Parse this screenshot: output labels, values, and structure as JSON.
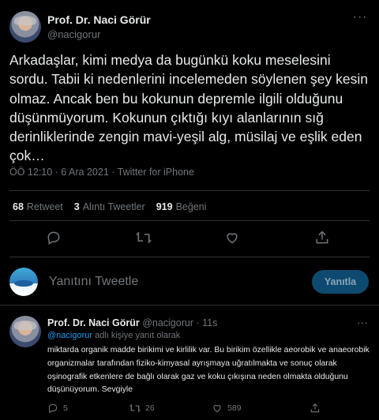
{
  "main_tweet": {
    "author_name": "Prof. Dr. Naci Görür",
    "author_handle": "@nacigorur",
    "text": "Arkadaşlar, kimi medya da bugünkü koku meselesini sordu. Tabii ki nedenlerini incelemeden söylenen şey kesin olmaz. Ancak ben bu kokunun depremle ilgili olduğunu düşünmüyorum. Kokunun çıktığı kıyı alanlarının sığ derinliklerinde zengin mavi-yeşil alg, müsilaj ve eşlik eden çok…",
    "meta": "ÖÖ 12:10 · 6 Ara 2021 · Twitter for iPhone",
    "stats": {
      "retweets_count": "68",
      "retweets_label": "Retweet",
      "quotes_count": "3",
      "quotes_label": "Alıntı Tweetler",
      "likes_count": "919",
      "likes_label": "Beğeni"
    }
  },
  "reply_composer": {
    "placeholder": "Yanıtını Tweetle",
    "button_label": "Yanıtla"
  },
  "reply_tweet": {
    "author_name": "Prof. Dr. Naci Görür",
    "author_handle": "@nacigorur",
    "time": "11s",
    "replying_mention": "@nacigorur",
    "replying_suffix": " adlı kişiye yanıt olarak",
    "text": "miktarda organik madde birikimi ve kirlilik var. Bu birikim özellikle aeorobik ve anaeorobik organizmalar tarafından fiziko-kimyasal ayrışmaya uğratılmakta ve sonuç olarak oşinografik etkenlere de bağlı olarak gaz ve koku çıkışına neden olmakta olduğunu düşünüyorum. Sevgiyle",
    "reply_count": "5",
    "retweet_count": "26",
    "like_count": "589"
  },
  "icons": [
    "more-icon",
    "reply-icon",
    "retweet-icon",
    "like-icon",
    "share-icon"
  ],
  "colors": {
    "background": "#000000",
    "text": "#e7e9ea",
    "muted": "#71767b",
    "accent": "#1d9bf0",
    "button_disabled": "#0e4a70"
  }
}
